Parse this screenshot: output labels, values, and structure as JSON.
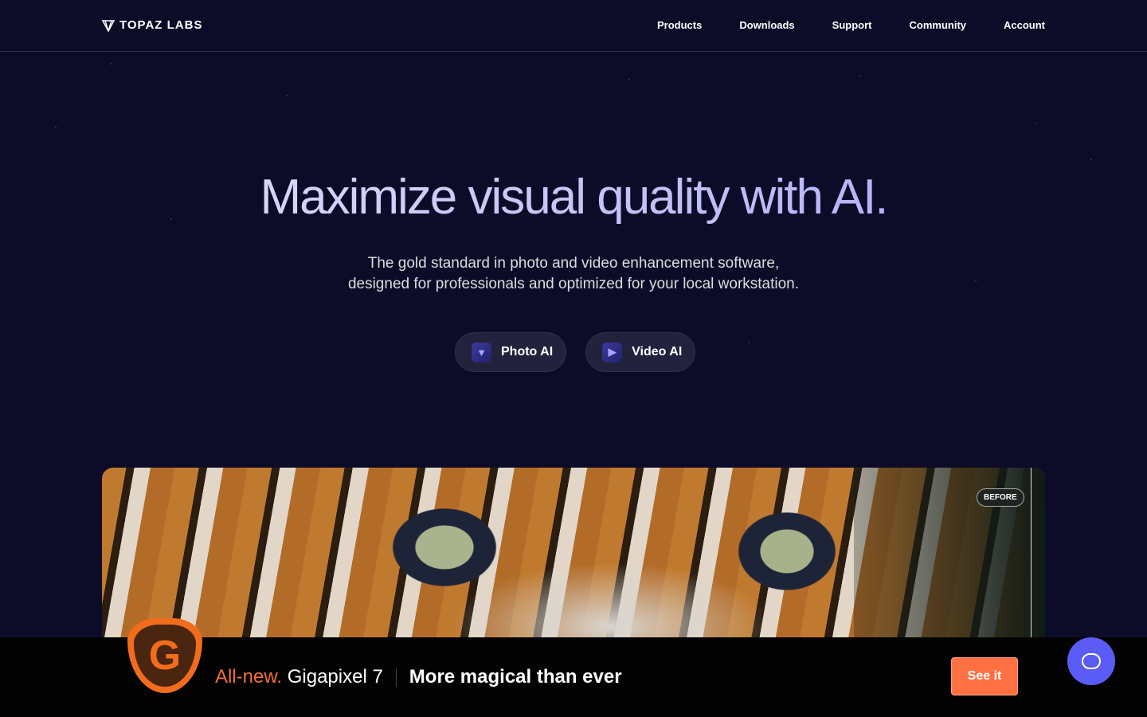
{
  "header": {
    "brand": "TOPAZ LABS",
    "nav": [
      "Products",
      "Downloads",
      "Support",
      "Community",
      "Account"
    ]
  },
  "hero": {
    "title": "Maximize visual quality with AI.",
    "subtitle_line1": "The gold standard in photo and video enhancement software,",
    "subtitle_line2": "designed for professionals and optimized for your local workstation.",
    "buttons": [
      {
        "label": "Photo AI",
        "icon": "photo-ai-gem-icon"
      },
      {
        "label": "Video AI",
        "icon": "video-ai-play-icon"
      }
    ]
  },
  "comparison": {
    "before_label": "BEFORE"
  },
  "banner": {
    "new": "All-new.",
    "product": "Gigapixel 7",
    "tagline": "More magical than ever",
    "cta": "See it",
    "icon_letter": "G",
    "accent": "#f26c1d"
  },
  "colors": {
    "background": "#0d0c28",
    "cta": "#ff7043",
    "chat": "#5b5cf6"
  }
}
